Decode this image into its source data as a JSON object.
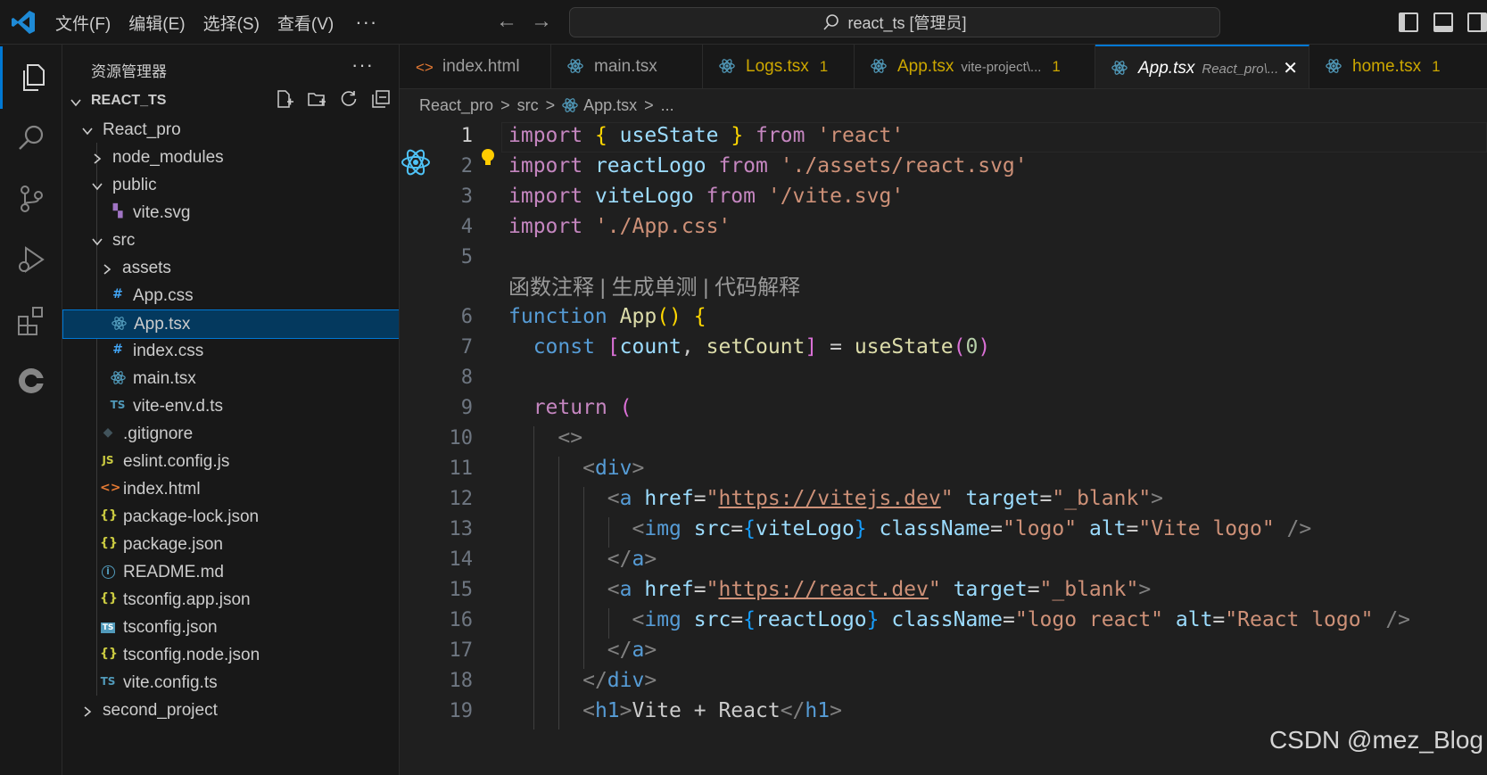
{
  "title_bar": {
    "menus": [
      "文件(F)",
      "编辑(E)",
      "选择(S)",
      "查看(V)"
    ],
    "more": "···",
    "back_arrow": "←",
    "forward_arrow": "→",
    "search_text": "react_ts [管理员]"
  },
  "activity_bar": {
    "items": [
      "explorer-icon",
      "search-icon",
      "source-control-icon",
      "run-debug-icon",
      "extensions-icon",
      "remote-icon"
    ],
    "active": "explorer-icon"
  },
  "sidebar": {
    "header": "资源管理器",
    "more": "···",
    "section_title": "REACT_TS",
    "tree": [
      {
        "label": "React_pro",
        "type": "folder-open",
        "depth": 1,
        "icon": ""
      },
      {
        "label": "node_modules",
        "type": "folder",
        "depth": 2,
        "icon": ""
      },
      {
        "label": "public",
        "type": "folder-open",
        "depth": 2,
        "icon": ""
      },
      {
        "label": "vite.svg",
        "type": "file",
        "depth": 3,
        "icon": "svg-file-icon"
      },
      {
        "label": "src",
        "type": "folder-open",
        "depth": 2,
        "icon": ""
      },
      {
        "label": "assets",
        "type": "folder",
        "depth": 3,
        "icon": ""
      },
      {
        "label": "App.css",
        "type": "file",
        "depth": 3,
        "icon": "css-file-icon"
      },
      {
        "label": "App.tsx",
        "type": "file",
        "depth": 3,
        "icon": "react-file-icon",
        "selected": true
      },
      {
        "label": "index.css",
        "type": "file",
        "depth": 3,
        "icon": "css-file-icon"
      },
      {
        "label": "main.tsx",
        "type": "file",
        "depth": 3,
        "icon": "react-file-icon"
      },
      {
        "label": "vite-env.d.ts",
        "type": "file",
        "depth": 3,
        "icon": "ts-file-icon"
      },
      {
        "label": ".gitignore",
        "type": "file",
        "depth": 2,
        "icon": "git-file-icon"
      },
      {
        "label": "eslint.config.js",
        "type": "file",
        "depth": 2,
        "icon": "js-file-icon"
      },
      {
        "label": "index.html",
        "type": "file",
        "depth": 2,
        "icon": "html-file-icon"
      },
      {
        "label": "package-lock.json",
        "type": "file",
        "depth": 2,
        "icon": "json-file-icon"
      },
      {
        "label": "package.json",
        "type": "file",
        "depth": 2,
        "icon": "json-file-icon"
      },
      {
        "label": "README.md",
        "type": "file",
        "depth": 2,
        "icon": "info-file-icon"
      },
      {
        "label": "tsconfig.app.json",
        "type": "file",
        "depth": 2,
        "icon": "json-file-icon"
      },
      {
        "label": "tsconfig.json",
        "type": "file",
        "depth": 2,
        "icon": "tsconfig-file-icon"
      },
      {
        "label": "tsconfig.node.json",
        "type": "file",
        "depth": 2,
        "icon": "json-file-icon"
      },
      {
        "label": "vite.config.ts",
        "type": "file",
        "depth": 2,
        "icon": "ts-file-icon"
      },
      {
        "label": "second_project",
        "type": "folder",
        "depth": 1,
        "icon": ""
      }
    ]
  },
  "tabs": [
    {
      "label": "index.html",
      "icon": "html-file-icon",
      "desc": "",
      "badge": ""
    },
    {
      "label": "main.tsx",
      "icon": "react-file-icon",
      "desc": "",
      "badge": ""
    },
    {
      "label": "Logs.tsx",
      "icon": "react-file-icon",
      "desc": "",
      "badge": "1",
      "warning": true
    },
    {
      "label": "App.tsx",
      "icon": "react-file-icon",
      "desc": "vite-project\\...",
      "badge": "1",
      "warning": true
    },
    {
      "label": "App.tsx",
      "icon": "react-file-icon",
      "desc": "React_pro\\...",
      "badge": "",
      "active": true,
      "close": "✕"
    },
    {
      "label": "home.tsx",
      "icon": "react-file-icon",
      "desc": "",
      "badge": "1",
      "warning": true
    }
  ],
  "breadcrumb": [
    "React_pro",
    "src",
    "App.tsx",
    "..."
  ],
  "codelens": "函数注释 | 生成单测 | 代码解释",
  "line_numbers": [
    "1",
    "2",
    "3",
    "4",
    "5",
    "6",
    "7",
    "8",
    "9",
    "10",
    "11",
    "12",
    "13",
    "14",
    "15",
    "16",
    "17",
    "18",
    "19"
  ],
  "watermark": "CSDN @mez_Blog",
  "colors": {
    "accent": "#0078d4",
    "keyword": "#c586c0",
    "string": "#ce9178",
    "variable": "#9cdcfe",
    "warning": "#cca700"
  }
}
